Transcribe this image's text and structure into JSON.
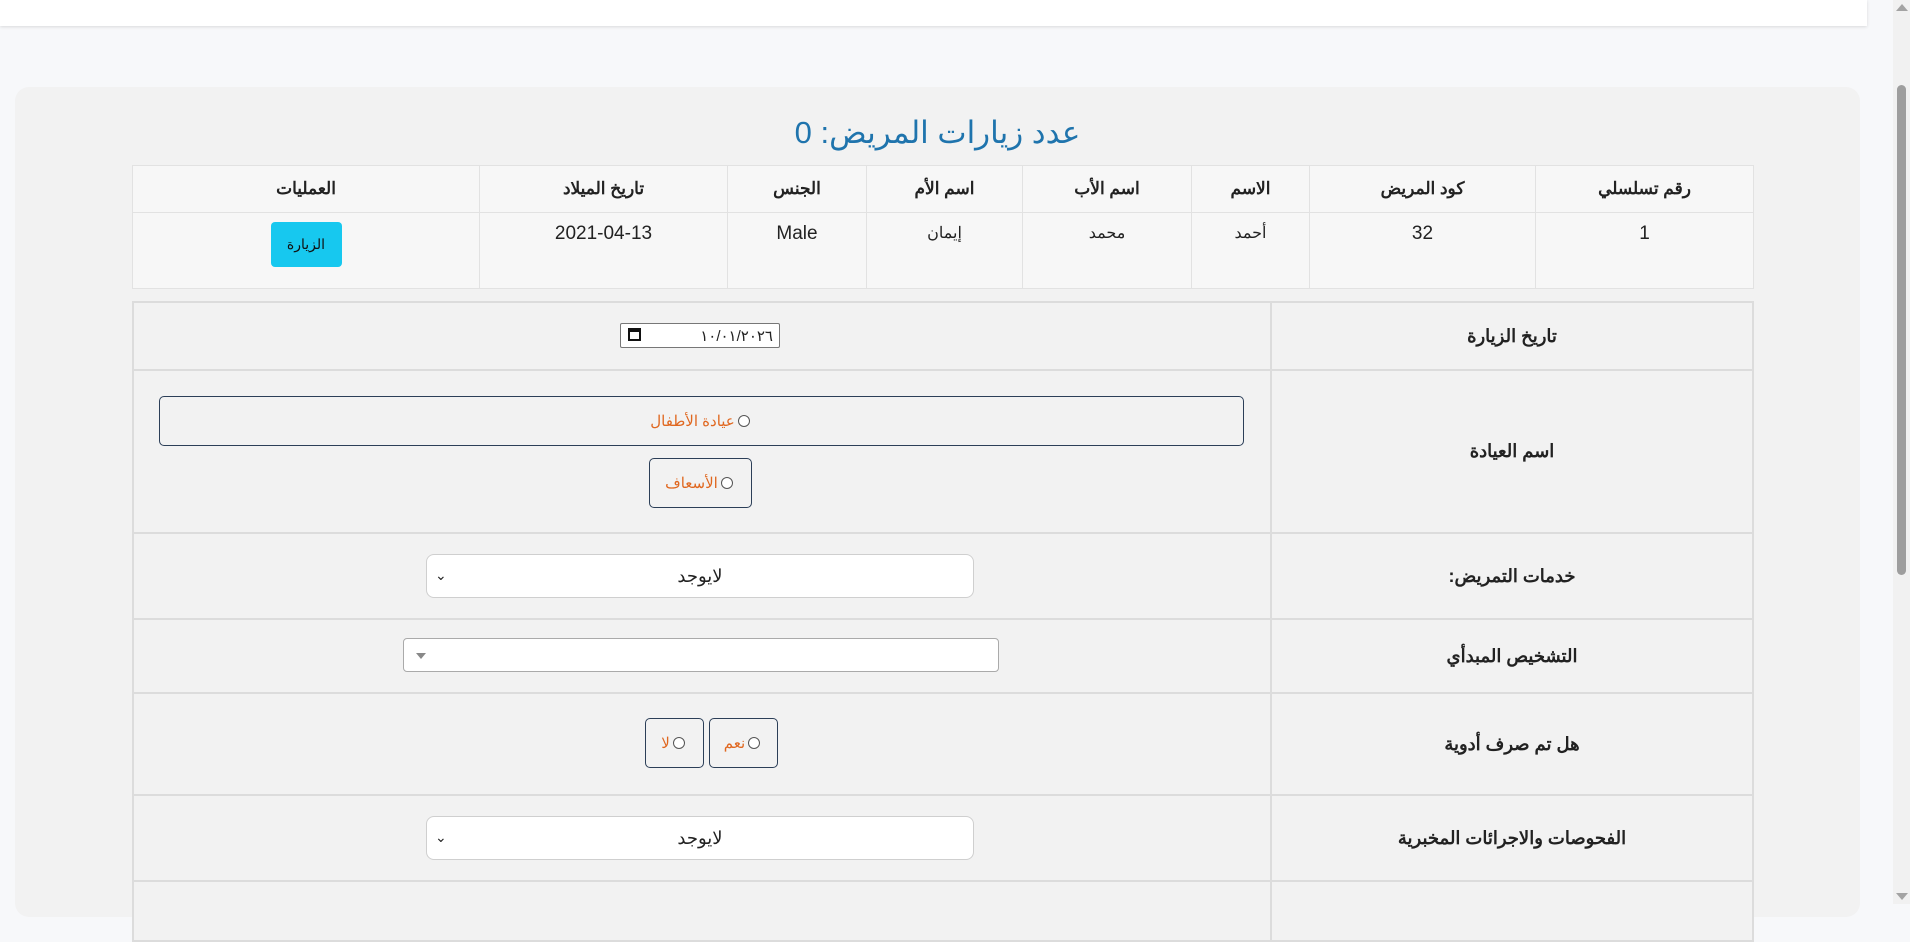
{
  "page": {
    "visits_title": "عدد زيارات المريض: 0"
  },
  "patient_table": {
    "headers": [
      "رقم تسلسلي",
      "كود المريض",
      "الاسم",
      "اسم الأب",
      "اسم الأم",
      "الجنس",
      "تاريخ الميلاد",
      "العمليات"
    ],
    "row": {
      "serial": "1",
      "code": "32",
      "name": "أحمد",
      "father": "محمد",
      "mother": "إيمان",
      "gender": "Male",
      "birth_date": "2021-04-13",
      "action_label": "الزيارة"
    }
  },
  "form": {
    "visit_date_label": "تاريخ الزيارة",
    "visit_date_value": "١٠/٠١/٢٠٢٦",
    "clinic_label": "اسم العيادة",
    "clinic_options": [
      "عيادة الأطفال",
      "الأسعاف"
    ],
    "nursing_label": "خدمات التمريض:",
    "nursing_value": "لايوجد",
    "diagnosis_label": "التشخيص المبدأي",
    "medication_label": "هل تم صرف أدوية",
    "medication_yes": "نعم",
    "medication_no": "لا",
    "labs_label": "الفحوصات والاجرائات المخبرية",
    "labs_value": "لايوجد"
  }
}
